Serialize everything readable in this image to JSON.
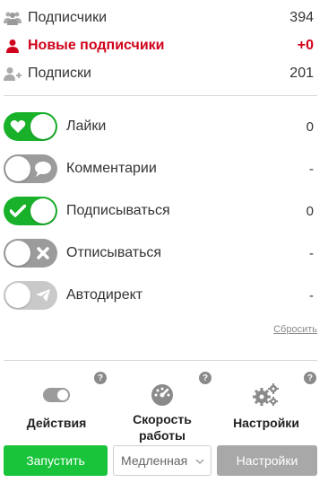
{
  "stats": {
    "followers": {
      "label": "Подписчики",
      "value": "394",
      "icon": "users-icon"
    },
    "new_followers": {
      "label": "Новые подписчики",
      "value": "+0",
      "icon": "user-icon",
      "color": "#d0021b"
    },
    "following": {
      "label": "Подписки",
      "value": "201",
      "icon": "user-add-icon"
    }
  },
  "toggles": [
    {
      "label": "Лайки",
      "value": "0",
      "state": "on",
      "icon": "heart-icon"
    },
    {
      "label": "Комментарии",
      "value": "-",
      "state": "off",
      "icon": "comment-icon"
    },
    {
      "label": "Подписываться",
      "value": "0",
      "state": "on",
      "icon": "check-icon"
    },
    {
      "label": "Отписываться",
      "value": "-",
      "state": "off",
      "icon": "close-icon"
    },
    {
      "label": "Автодирект",
      "value": "-",
      "state": "off",
      "icon": "send-icon"
    }
  ],
  "reset_label": "Сбросить",
  "features": {
    "actions": {
      "label": "Действия",
      "icon": "toggle-icon"
    },
    "speed": {
      "label": "Скорость работы",
      "icon": "speedometer-icon"
    },
    "settings": {
      "label": "Настройки",
      "icon": "gears-icon"
    }
  },
  "help_glyph": "?",
  "controls": {
    "start_label": "Запустить",
    "speed_selected": "Медленная",
    "settings_label": "Настройки"
  },
  "colors": {
    "accent_green": "#19c43a",
    "toggle_on": "#19b12a",
    "toggle_off": "#9b9b9b",
    "alert_red": "#d0021b",
    "button_gray": "#a8a8a8"
  }
}
